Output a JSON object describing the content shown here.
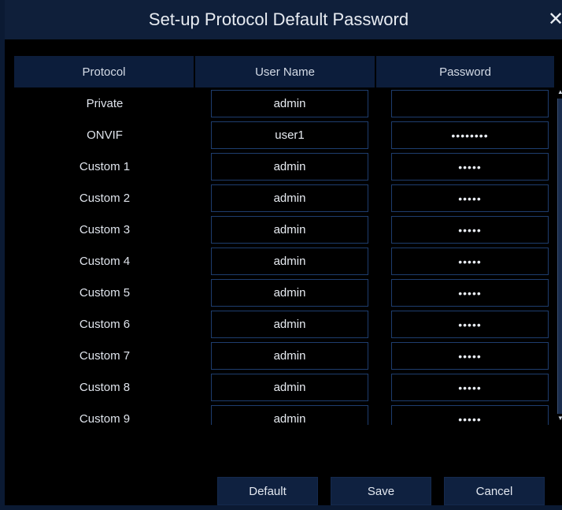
{
  "dialog": {
    "title": "Set-up Protocol Default Password",
    "close_icon": "close-icon",
    "close_glyph": "✕"
  },
  "table": {
    "columns": [
      "Protocol",
      "User Name",
      "Password"
    ],
    "rows": [
      {
        "protocol": "Private",
        "user": "admin",
        "password": ""
      },
      {
        "protocol": "ONVIF",
        "user": "user1",
        "password": "••••••••"
      },
      {
        "protocol": "Custom 1",
        "user": "admin",
        "password": "•••••"
      },
      {
        "protocol": "Custom 2",
        "user": "admin",
        "password": "•••••"
      },
      {
        "protocol": "Custom 3",
        "user": "admin",
        "password": "•••••"
      },
      {
        "protocol": "Custom 4",
        "user": "admin",
        "password": "•••••"
      },
      {
        "protocol": "Custom 5",
        "user": "admin",
        "password": "•••••"
      },
      {
        "protocol": "Custom 6",
        "user": "admin",
        "password": "•••••"
      },
      {
        "protocol": "Custom 7",
        "user": "admin",
        "password": "•••••"
      },
      {
        "protocol": "Custom 8",
        "user": "admin",
        "password": "•••••"
      },
      {
        "protocol": "Custom 9",
        "user": "admin",
        "password": "•••••"
      }
    ]
  },
  "buttons": {
    "default_label": "Default",
    "save_label": "Save",
    "cancel_label": "Cancel"
  },
  "colors": {
    "title_bar": "#0f1f3a",
    "header_cell": "#0c1d3b",
    "field_border": "#1e3d6e",
    "button_bg": "#0f2140"
  }
}
